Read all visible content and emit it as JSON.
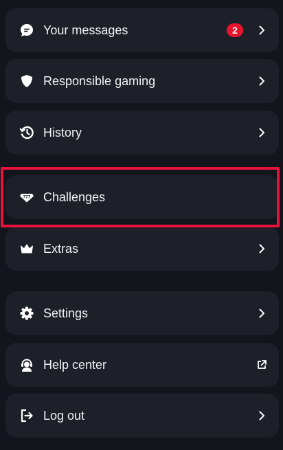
{
  "menu": {
    "items": [
      {
        "label": "Your messages",
        "icon": "chat-bubble-icon",
        "badge": "2",
        "trail": "chevron-right-icon"
      },
      {
        "label": "Responsible gaming",
        "icon": "shield-icon",
        "trail": "chevron-right-icon"
      },
      {
        "label": "History",
        "icon": "history-icon",
        "trail": "chevron-right-icon"
      },
      {
        "label": "Challenges",
        "icon": "challenges-777-icon"
      },
      {
        "label": "Extras",
        "icon": "crown-icon",
        "trail": "chevron-right-icon"
      },
      {
        "label": "Settings",
        "icon": "gear-icon",
        "trail": "chevron-right-icon"
      },
      {
        "label": "Help center",
        "icon": "support-agent-icon",
        "trail": "external-link-icon"
      },
      {
        "label": "Log out",
        "icon": "logout-icon",
        "trail": "chevron-right-icon"
      }
    ]
  },
  "highlight": {
    "target": "Challenges",
    "color": "#e8123c"
  },
  "colors": {
    "background": "#12151b",
    "card": "#1d2028",
    "badge": "#e8142e"
  }
}
